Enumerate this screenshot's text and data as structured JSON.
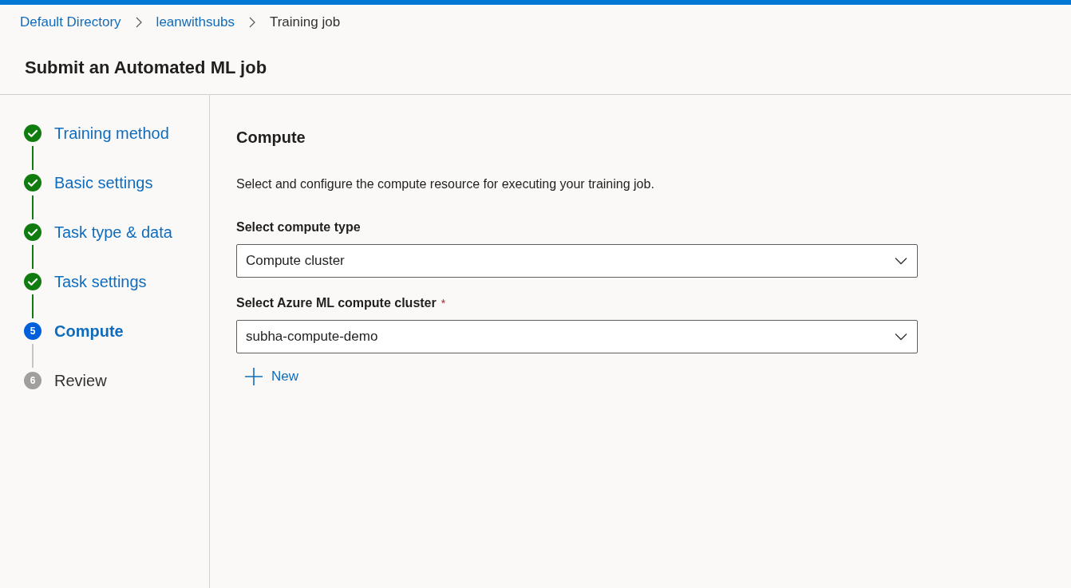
{
  "breadcrumb": [
    {
      "label": "Default Directory",
      "kind": "link"
    },
    {
      "label": "leanwithsubs",
      "kind": "link"
    },
    {
      "label": "Training job",
      "kind": "current"
    }
  ],
  "page_title": "Submit an Automated ML job",
  "steps": [
    {
      "label": "Training method",
      "completed": true,
      "selected": false
    },
    {
      "label": "Basic settings",
      "completed": true,
      "selected": false
    },
    {
      "label": "Task type & data",
      "completed": true,
      "selected": false
    },
    {
      "label": "Task settings",
      "completed": true,
      "selected": false
    },
    {
      "label": "Compute",
      "completed": false,
      "selected": true,
      "number": "5"
    },
    {
      "label": "Review",
      "completed": false,
      "selected": false,
      "number": "6"
    }
  ],
  "section": {
    "title": "Compute",
    "description": "Select and configure the compute resource for executing your training job.",
    "fields": [
      {
        "label": "Select compute type",
        "value": "Compute cluster"
      },
      {
        "label": "Select Azure ML compute cluster",
        "required_mark": "*",
        "value": "subha-compute-demo"
      }
    ],
    "new_button": "New"
  }
}
